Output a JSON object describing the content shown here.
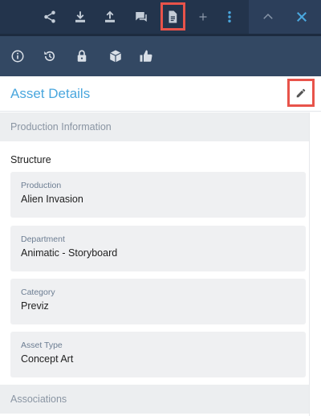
{
  "toolbar": {
    "icons": [
      "share-icon",
      "download-icon",
      "upload-icon",
      "comment-icon",
      "document-icon",
      "plus-icon",
      "more-vertical-icon",
      "chevron-up-icon",
      "close-icon"
    ]
  },
  "iconbar": {
    "icons": [
      "info-icon",
      "history-icon",
      "lock-icon",
      "package-icon",
      "thumbs-up-icon"
    ]
  },
  "header": {
    "title": "Asset Details"
  },
  "sections": {
    "production_info": "Production Information",
    "associations": "Associations"
  },
  "structure": {
    "title": "Structure",
    "fields": [
      {
        "label": "Production",
        "value": "Alien Invasion"
      },
      {
        "label": "Department",
        "value": "Animatic - Storyboard"
      },
      {
        "label": "Category",
        "value": "Previz"
      },
      {
        "label": "Asset Type",
        "value": "Concept Art"
      }
    ]
  },
  "colors": {
    "topbar": "#23344c",
    "iconbar": "#334863",
    "accent": "#4aa7de",
    "highlight": "#e8534a"
  }
}
